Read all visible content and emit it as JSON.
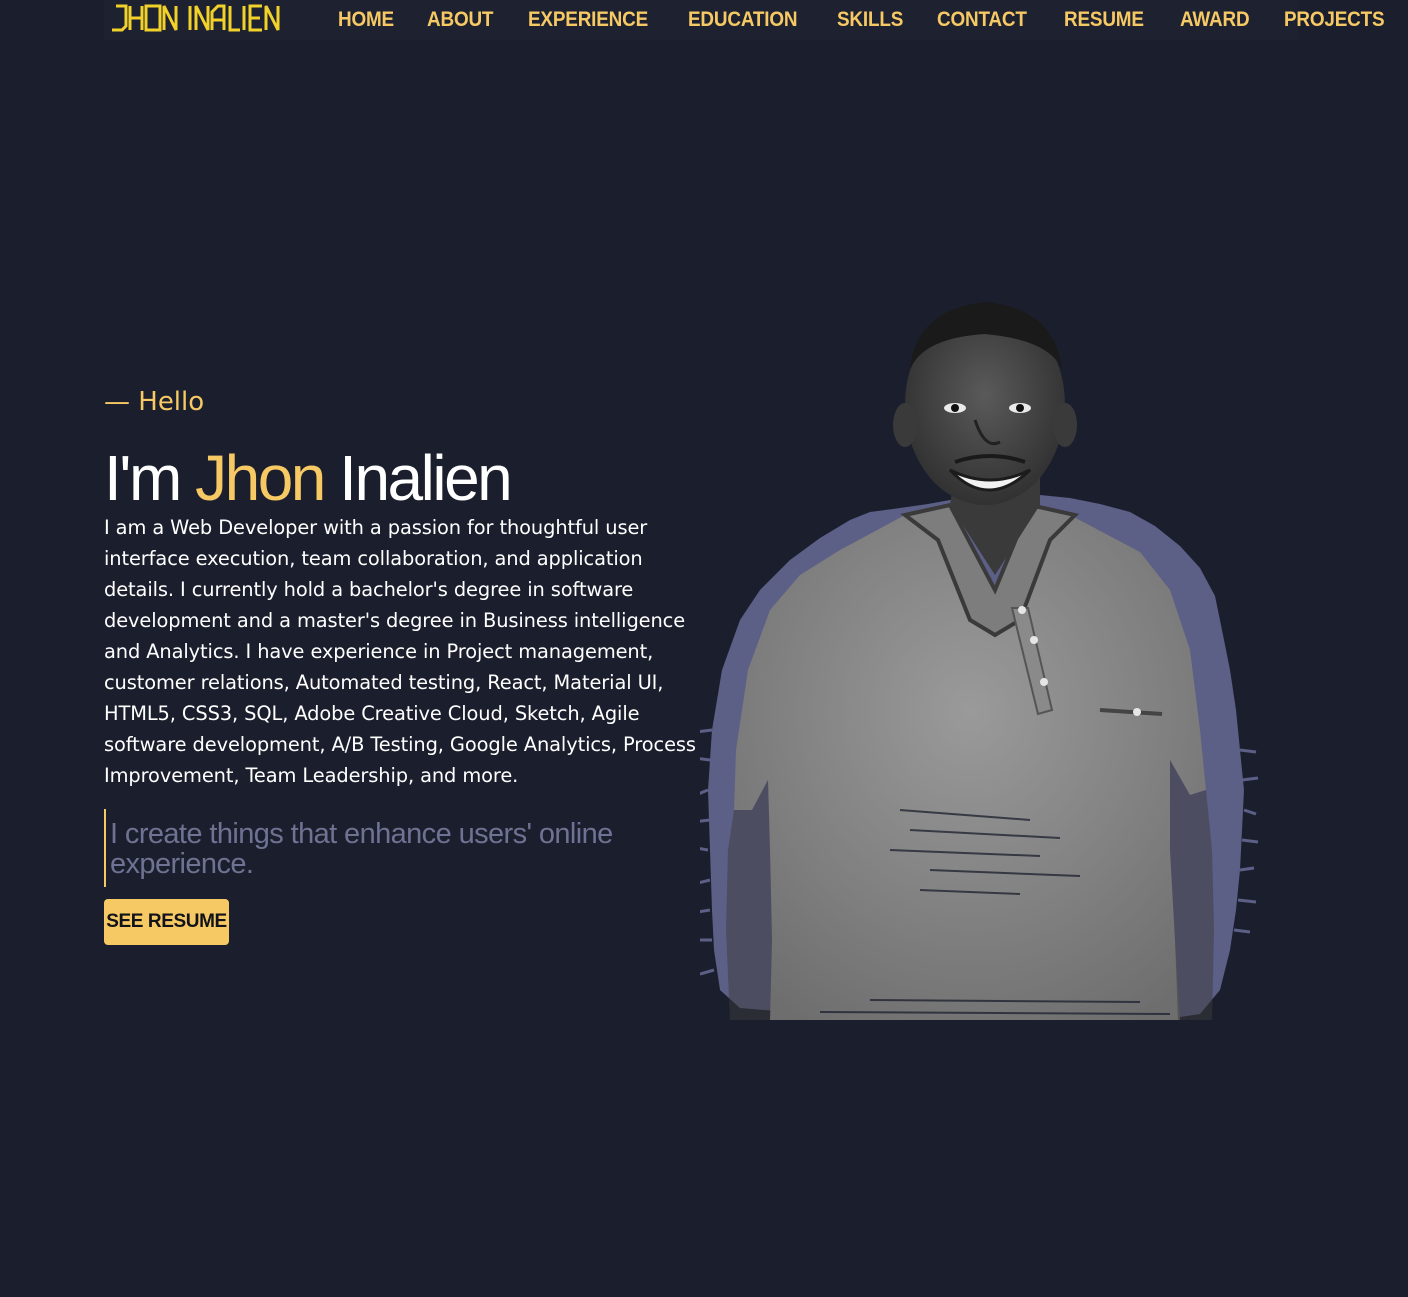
{
  "brand": {
    "logo_text": "JHON INALIEN"
  },
  "nav": {
    "items": [
      {
        "label": "HOME"
      },
      {
        "label": "ABOUT"
      },
      {
        "label": "EXPERIENCE"
      },
      {
        "label": "EDUCATION"
      },
      {
        "label": "SKILLS"
      },
      {
        "label": "CONTACT"
      },
      {
        "label": "RESUME"
      },
      {
        "label": "AWARD"
      },
      {
        "label": "PROJECTS"
      }
    ]
  },
  "hero": {
    "greeting": "— Hello",
    "intro": "I'm",
    "first_name": "Jhon",
    "last_name": "Inalien",
    "bio": "I am a Web Developer with a passion for thoughtful user interface execution, team collaboration, and application details. I currently hold a bachelor's degree in software development and a master's degree in Business intelligence and Analytics. I have experience in Project management, customer relations, Automated testing, React, Material UI, HTML5, CSS3, SQL, Adobe Creative Cloud, Sketch, Agile software development, A/B Testing, Google Analytics, Process Improvement, Team Leadership, and more.",
    "tagline": "I create things that enhance users' online experience.",
    "cta_label": "SEE RESUME"
  },
  "colors": {
    "background": "#1b1f2d",
    "navbar": "#1e2230",
    "accent": "#f6c964",
    "text": "#ffffff",
    "muted": "#6f7292",
    "portrait_backdrop": "#5c5f86"
  },
  "icons": {
    "portrait": "person-photo"
  }
}
